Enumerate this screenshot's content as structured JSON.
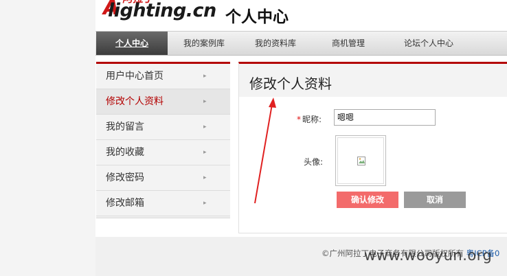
{
  "header": {
    "logo_cn": "阿拉丁",
    "logo_a": "A",
    "logo_main": "lighting.cn",
    "title": "个人中心"
  },
  "nav": {
    "items": [
      {
        "label": "个人中心",
        "active": true
      },
      {
        "label": "我的案例库",
        "active": false
      },
      {
        "label": "我的资料库",
        "active": false
      },
      {
        "label": "商机管理",
        "active": false
      },
      {
        "label": "论坛个人中心",
        "active": false
      }
    ]
  },
  "sidebar": {
    "arrow": "▸",
    "items": [
      {
        "label": "用户中心首页",
        "active": false
      },
      {
        "label": "修改个人资料",
        "active": true
      },
      {
        "label": "我的留言",
        "active": false
      },
      {
        "label": "我的收藏",
        "active": false
      },
      {
        "label": "修改密码",
        "active": false
      },
      {
        "label": "修改邮箱",
        "active": false
      }
    ]
  },
  "main": {
    "title": "修改个人资料",
    "nickname_required": "*",
    "nickname_label": "昵称:",
    "nickname_value": "嗯嗯",
    "avatar_label": "头像:",
    "confirm_label": "确认修改",
    "cancel_label": "取消"
  },
  "footer": {
    "copyright": "©广州阿拉丁电子商务有限公司版权所有",
    "icp_link": "粤ICP备0"
  },
  "watermark": "www.wooyun.org",
  "colors": {
    "accent": "#b30000",
    "confirm_button": "#f36b6b",
    "cancel_button": "#9a9a9a",
    "annotation_arrow": "#e02020"
  }
}
